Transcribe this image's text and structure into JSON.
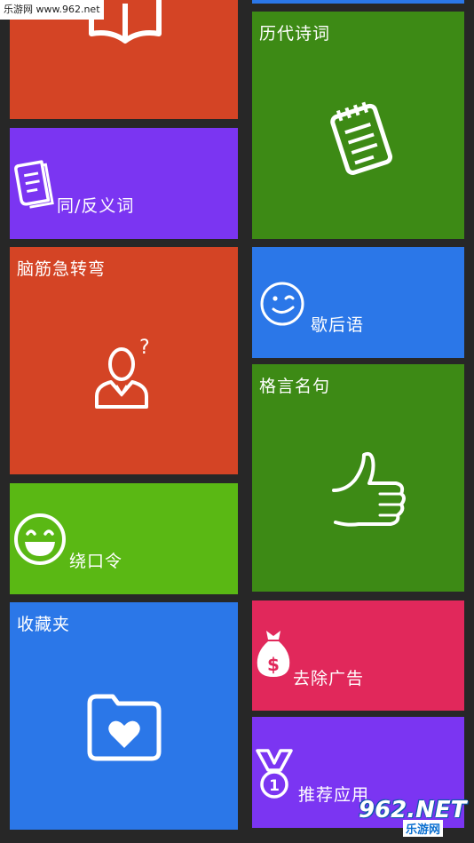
{
  "watermark": {
    "site": "乐游网 www.962.net",
    "logo_big": "962.NET",
    "logo_small": "乐游网"
  },
  "colors": {
    "orange_red": "#d44425",
    "purple": "#7b35f2",
    "green": "#3d8a15",
    "lime": "#5ab814",
    "blue": "#2b77e8",
    "pink": "#e1285b",
    "background": "#272727"
  },
  "tiles": {
    "reading": {
      "icon": "open-book-icon"
    },
    "poetry": {
      "label": "历代诗词",
      "icon": "notepad-icon"
    },
    "synonyms": {
      "label": "同/反义词",
      "icon": "dictionary-icon"
    },
    "riddles": {
      "label": "脑筋急转弯",
      "icon": "thinking-person-icon"
    },
    "xiehouyu": {
      "label": "歇后语",
      "icon": "wink-face-icon"
    },
    "proverbs": {
      "label": "格言名句",
      "icon": "thumbs-up-icon"
    },
    "tongue_twister": {
      "label": "绕口令",
      "icon": "smile-face-icon"
    },
    "favorites": {
      "label": "收藏夹",
      "icon": "heart-folder-icon"
    },
    "remove_ads": {
      "label": "去除广告",
      "icon": "money-bag-icon"
    },
    "recommend": {
      "label": "推荐应用",
      "icon": "medal-icon"
    }
  }
}
